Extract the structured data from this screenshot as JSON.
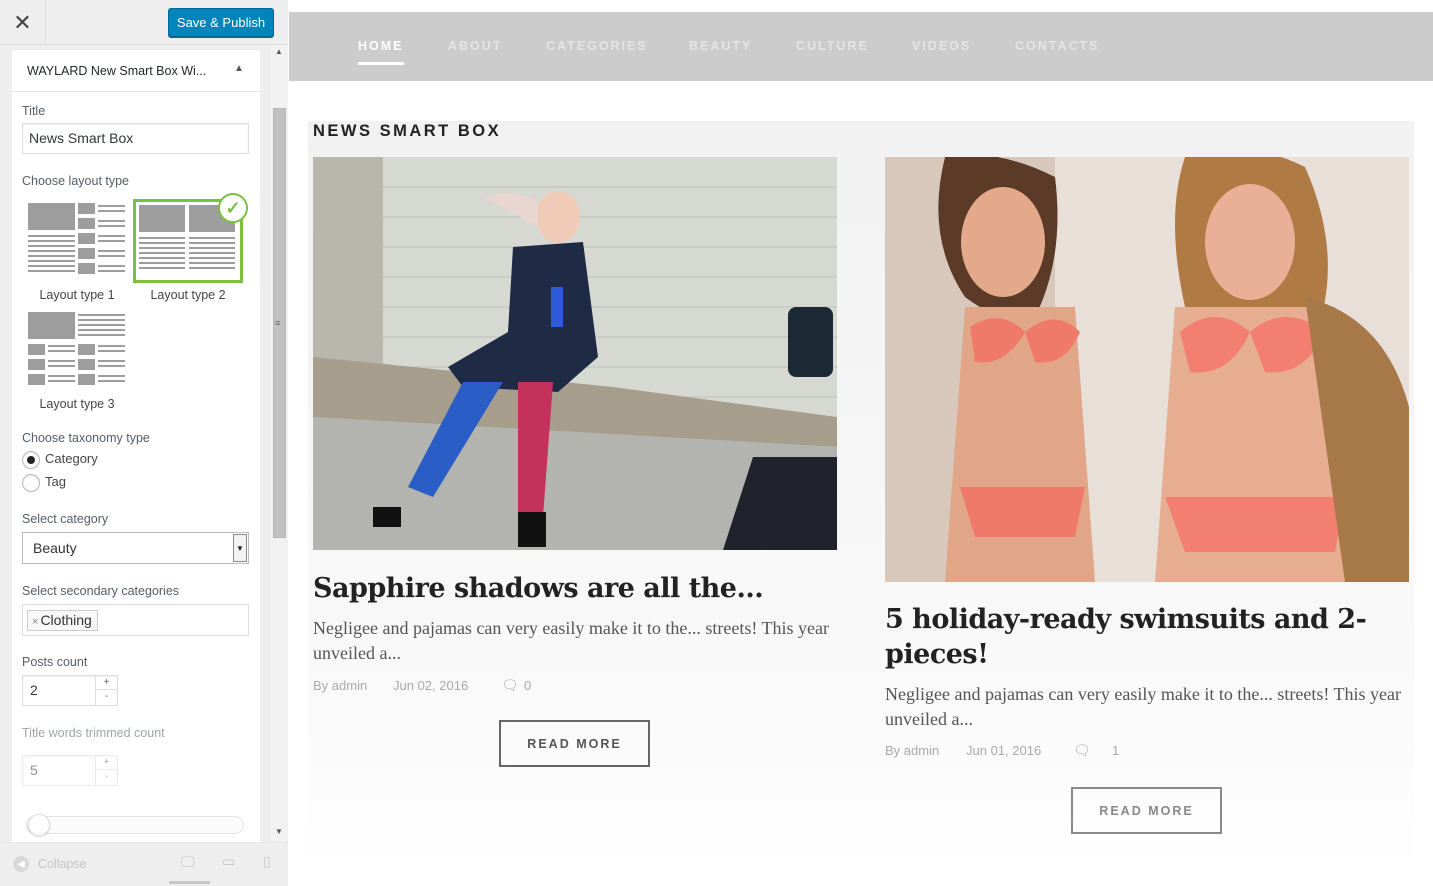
{
  "customizer": {
    "close_icon": "close-icon",
    "publish_label": "Save & Publish",
    "section_title": "WAYLARD New Smart Box Wi...",
    "title_label": "Title",
    "title_value": "News Smart Box",
    "layout_label": "Choose layout type",
    "layouts": [
      {
        "caption": "Layout type 1",
        "selected": false
      },
      {
        "caption": "Layout type 2",
        "selected": true
      },
      {
        "caption": "Layout type 3",
        "selected": false
      }
    ],
    "taxonomy_label": "Choose taxonomy type",
    "taxonomy_options": [
      {
        "label": "Category",
        "checked": true
      },
      {
        "label": "Tag",
        "checked": false
      }
    ],
    "category_label": "Select category",
    "category_value": "Beauty",
    "secondary_label": "Select secondary categories",
    "secondary_chips": [
      "Clothing"
    ],
    "secondary_chip_remove": "×",
    "posts_count_label": "Posts count",
    "posts_count_value": "2",
    "title_trim_label": "Title words trimmed count",
    "title_trim_value": "5",
    "stepper_up": "+",
    "stepper_down": "-",
    "collapse_label": "Collapse"
  },
  "site": {
    "nav": [
      "HOME",
      "ABOUT",
      "CATEGORIES",
      "BEAUTY",
      "CULTURE",
      "VIDEOS",
      "CONTACTS"
    ],
    "nav_active": "HOME",
    "box_title": "NEWS SMART BOX",
    "articles": [
      {
        "title": "Sapphire shadows are all the...",
        "excerpt": "Negligee and pajamas can very easily make it to the... streets! This year unveiled a...",
        "author": "By admin",
        "date": "Jun 02, 2016",
        "comments": "0",
        "read_more": "READ MORE"
      },
      {
        "title": "5 holiday-ready swimsuits and 2-pieces!",
        "excerpt": "Negligee and pajamas can very easily make it to the... streets! This year unveiled a...",
        "author": "By admin",
        "date": "Jun 01, 2016",
        "comments": "1",
        "read_more": "READ MORE"
      }
    ]
  },
  "colors": {
    "publish_button": "#0085ba",
    "selected_layout": "#7ac142",
    "nav_bar": "#cccccc"
  }
}
